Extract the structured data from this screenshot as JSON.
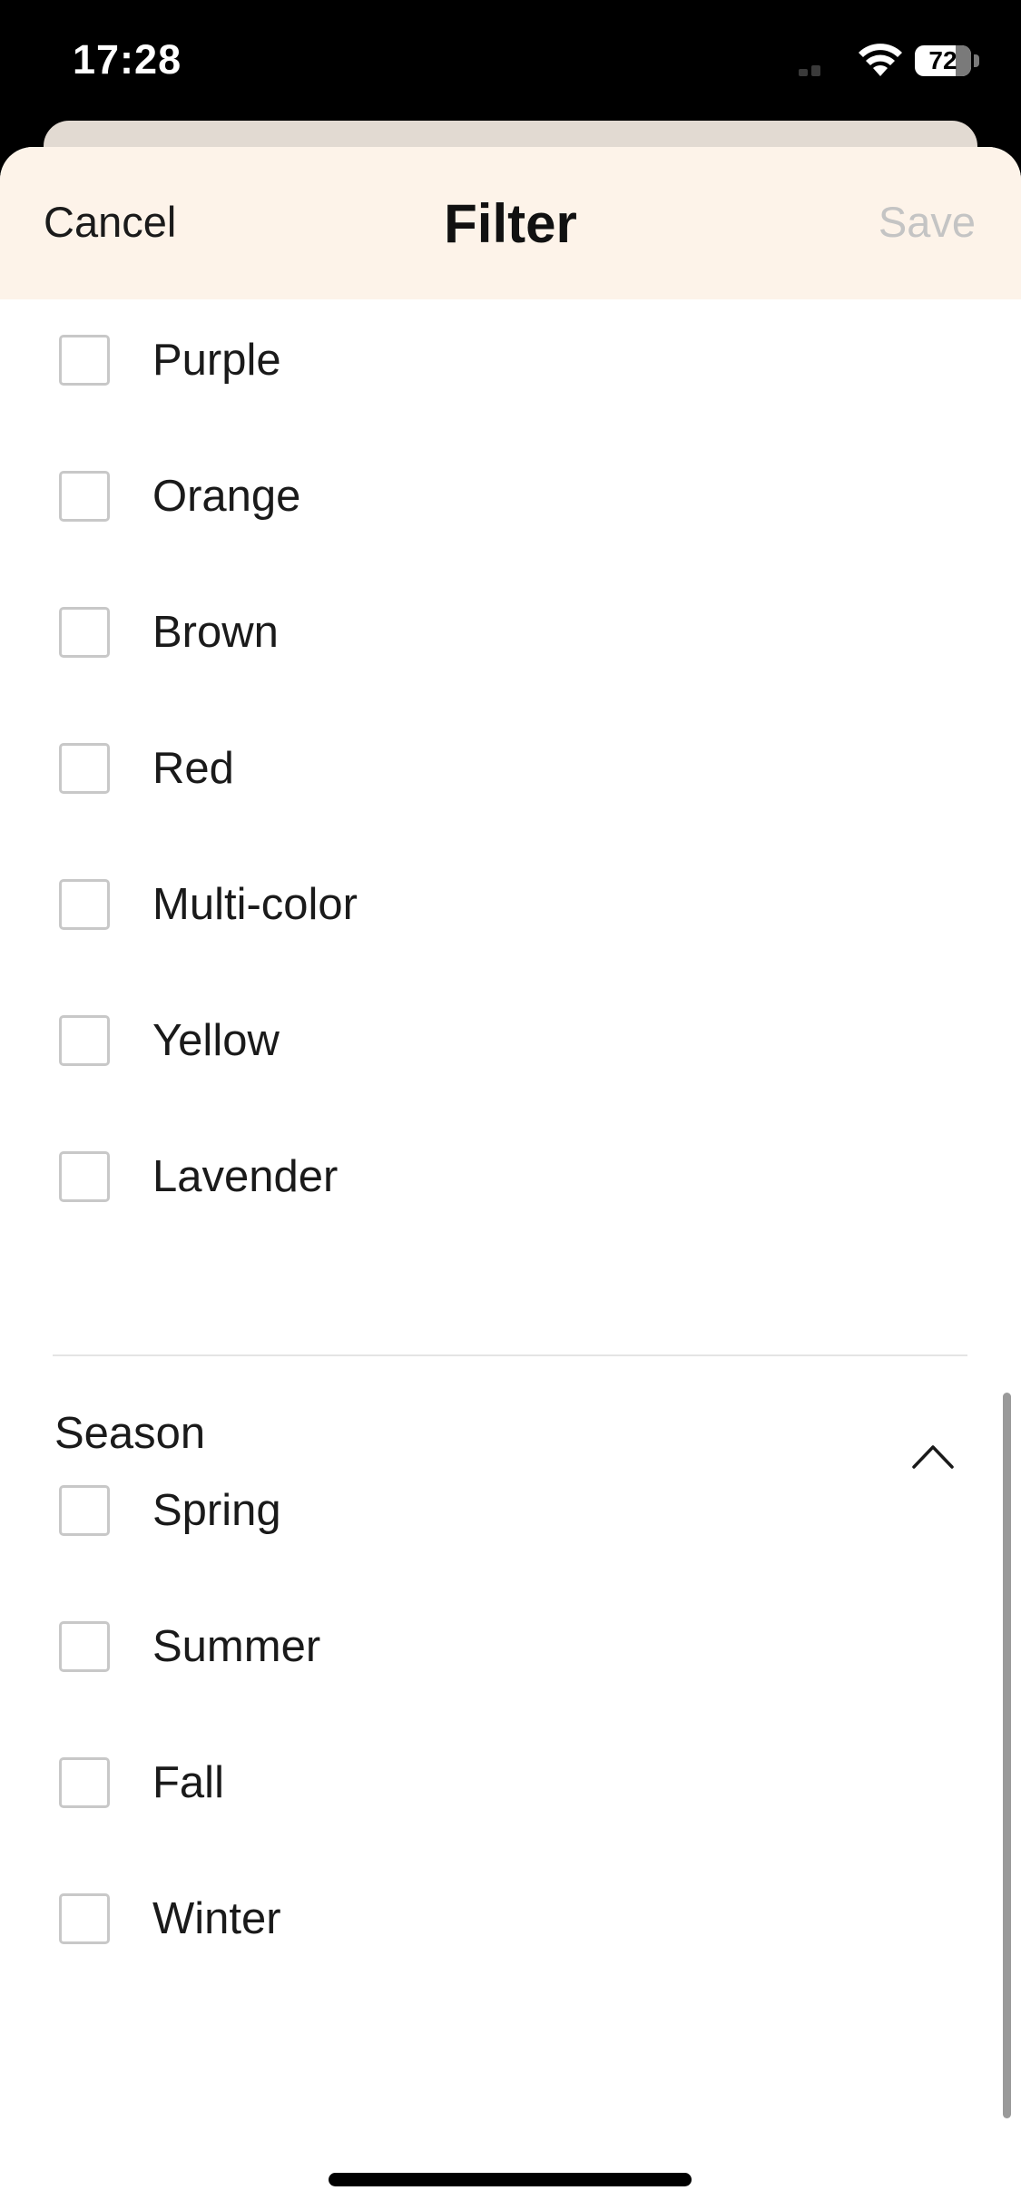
{
  "status_bar": {
    "time": "17:28",
    "battery_level": "72",
    "battery_fraction": 0.72
  },
  "header": {
    "cancel_label": "Cancel",
    "title": "Filter",
    "save_label": "Save"
  },
  "color_options": [
    {
      "label": "Purple",
      "checked": false
    },
    {
      "label": "Orange",
      "checked": false
    },
    {
      "label": "Brown",
      "checked": false
    },
    {
      "label": "Red",
      "checked": false
    },
    {
      "label": "Multi-color",
      "checked": false
    },
    {
      "label": "Yellow",
      "checked": false
    },
    {
      "label": "Lavender",
      "checked": false
    }
  ],
  "season_section": {
    "title": "Season",
    "expanded": true,
    "options": [
      {
        "label": "Spring",
        "checked": false
      },
      {
        "label": "Summer",
        "checked": false
      },
      {
        "label": "Fall",
        "checked": false
      },
      {
        "label": "Winter",
        "checked": false
      }
    ]
  },
  "colors": {
    "header_bg": "#fdf3e9",
    "save_disabled": "#c4c4c4",
    "checkbox_border": "#c8c8c8"
  }
}
